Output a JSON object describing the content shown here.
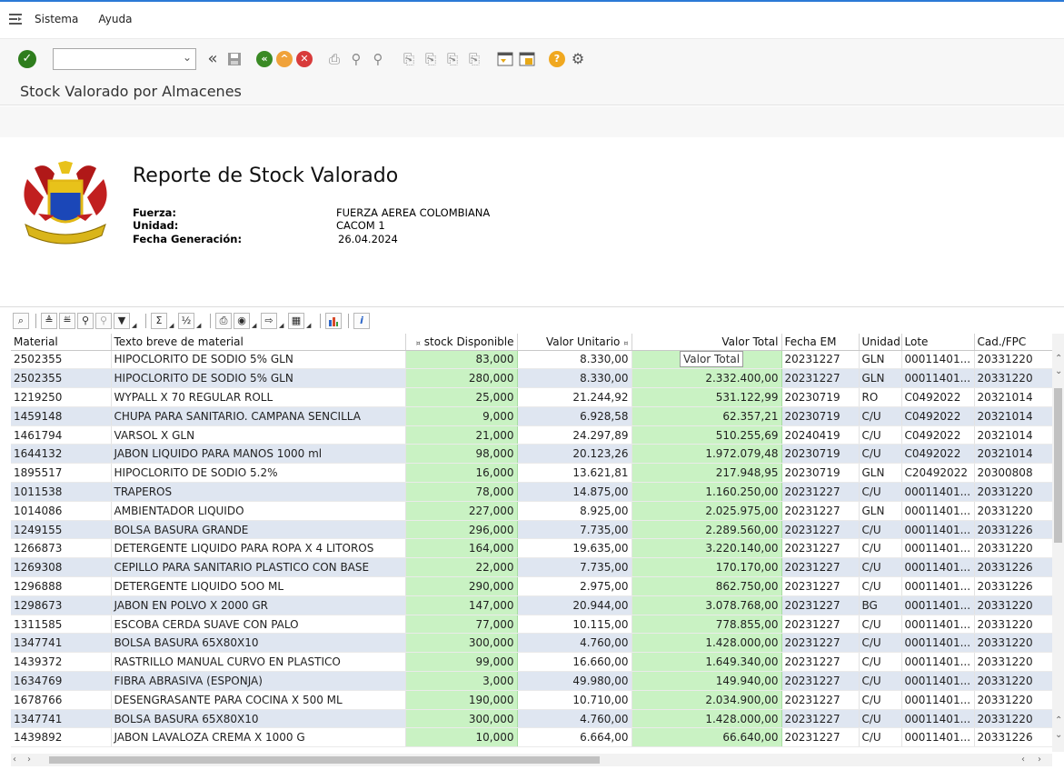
{
  "menu": {
    "sistema": "Sistema",
    "ayuda": "Ayuda"
  },
  "screen_title": "Stock Valorado por Almacenes",
  "report": {
    "title": "Reporte de Stock Valorado",
    "fuerza_label": "Fuerza:",
    "fuerza_value": "FUERZA AEREA COLOMBIANA",
    "unidad_label": "Unidad:",
    "unidad_value": "CACOM 1",
    "fecha_label": "Fecha Generación:",
    "fecha_value": "26.04.2024"
  },
  "table": {
    "columns": [
      "Material",
      "Texto breve de material",
      "stock Disponible",
      "Valor Unitario",
      "Valor Total",
      "Fecha EM",
      "Unidad",
      "Lote",
      "Cad./FPC"
    ],
    "rows": [
      [
        "2502355",
        "HIPOCLORITO DE SODIO 5% GLN",
        "83,000",
        "8.330,00",
        "",
        "20231227",
        "GLN",
        "00011401...",
        "20331220"
      ],
      [
        "2502355",
        "HIPOCLORITO DE SODIO 5% GLN",
        "280,000",
        "8.330,00",
        "2.332.400,00",
        "20231227",
        "GLN",
        "00011401...",
        "20331220"
      ],
      [
        "1219250",
        "WYPALL X 70 REGULAR ROLL",
        "25,000",
        "21.244,92",
        "531.122,99",
        "20230719",
        "RO",
        "C0492022",
        "20321014"
      ],
      [
        "1459148",
        "CHUPA  PARA SANITARIO. CAMPANA SENCILLA",
        "9,000",
        "6.928,58",
        "62.357,21",
        "20230719",
        "C/U",
        "C0492022",
        "20321014"
      ],
      [
        "1461794",
        "VARSOL  X GLN",
        "21,000",
        "24.297,89",
        "510.255,69",
        "20240419",
        "C/U",
        "C0492022",
        "20321014"
      ],
      [
        "1644132",
        "JABON LIQUIDO PARA MANOS 1000 ml",
        "98,000",
        "20.123,26",
        "1.972.079,48",
        "20230719",
        "C/U",
        "C0492022",
        "20321014"
      ],
      [
        "1895517",
        "HIPOCLORITO DE SODIO 5.2%",
        "16,000",
        "13.621,81",
        "217.948,95",
        "20230719",
        "GLN",
        "C20492022",
        "20300808"
      ],
      [
        "1011538",
        "TRAPEROS",
        "78,000",
        "14.875,00",
        "1.160.250,00",
        "20231227",
        "C/U",
        "00011401...",
        "20331220"
      ],
      [
        "1014086",
        "AMBIENTADOR LIQUIDO",
        "227,000",
        "8.925,00",
        "2.025.975,00",
        "20231227",
        "GLN",
        "00011401...",
        "20331220"
      ],
      [
        "1249155",
        "BOLSA  BASURA GRANDE",
        "296,000",
        "7.735,00",
        "2.289.560,00",
        "20231227",
        "C/U",
        "00011401...",
        "20331226"
      ],
      [
        "1266873",
        "DETERGENTE LIQUIDO PARA ROPA X 4 LITOROS",
        "164,000",
        "19.635,00",
        "3.220.140,00",
        "20231227",
        "C/U",
        "00011401...",
        "20331220"
      ],
      [
        "1269308",
        "CEPILLO PARA SANITARIO PLASTICO CON BASE",
        "22,000",
        "7.735,00",
        "170.170,00",
        "20231227",
        "C/U",
        "00011401...",
        "20331226"
      ],
      [
        "1296888",
        "DETERGENTE LIQUIDO 5OO ML",
        "290,000",
        "2.975,00",
        "862.750,00",
        "20231227",
        "C/U",
        "00011401...",
        "20331226"
      ],
      [
        "1298673",
        "JABON EN POLVO X 2000 GR",
        "147,000",
        "20.944,00",
        "3.078.768,00",
        "20231227",
        "BG",
        "00011401...",
        "20331220"
      ],
      [
        "1311585",
        "ESCOBA CERDA SUAVE CON PALO",
        "77,000",
        "10.115,00",
        "778.855,00",
        "20231227",
        "C/U",
        "00011401...",
        "20331220"
      ],
      [
        "1347741",
        "BOLSA BASURA 65X80X10",
        "300,000",
        "4.760,00",
        "1.428.000,00",
        "20231227",
        "C/U",
        "00011401...",
        "20331220"
      ],
      [
        "1439372",
        "RASTRILLO MANUAL CURVO EN PLASTICO",
        "99,000",
        "16.660,00",
        "1.649.340,00",
        "20231227",
        "C/U",
        "00011401...",
        "20331220"
      ],
      [
        "1634769",
        "FIBRA ABRASIVA (ESPONJA)",
        "3,000",
        "49.980,00",
        "149.940,00",
        "20231227",
        "C/U",
        "00011401...",
        "20331220"
      ],
      [
        "1678766",
        "DESENGRASANTE PARA COCINA X 500 ML",
        "190,000",
        "10.710,00",
        "2.034.900,00",
        "20231227",
        "C/U",
        "00011401...",
        "20331220"
      ],
      [
        "1347741",
        "BOLSA BASURA 65X80X10",
        "300,000",
        "4.760,00",
        "1.428.000,00",
        "20231227",
        "C/U",
        "00011401...",
        "20331220"
      ],
      [
        "1439892",
        "JABON LAVALOZA CREMA X 1000 G",
        "10,000",
        "6.664,00",
        "66.640,00",
        "20231227",
        "C/U",
        "00011401...",
        "20331226"
      ]
    ]
  },
  "tooltip": "Valor Total",
  "colors": {
    "accent": "#2b79d6",
    "ok": "#2e7d1d",
    "green_cell": "#c9f2c3",
    "row_alt": "#dfe6f1"
  }
}
